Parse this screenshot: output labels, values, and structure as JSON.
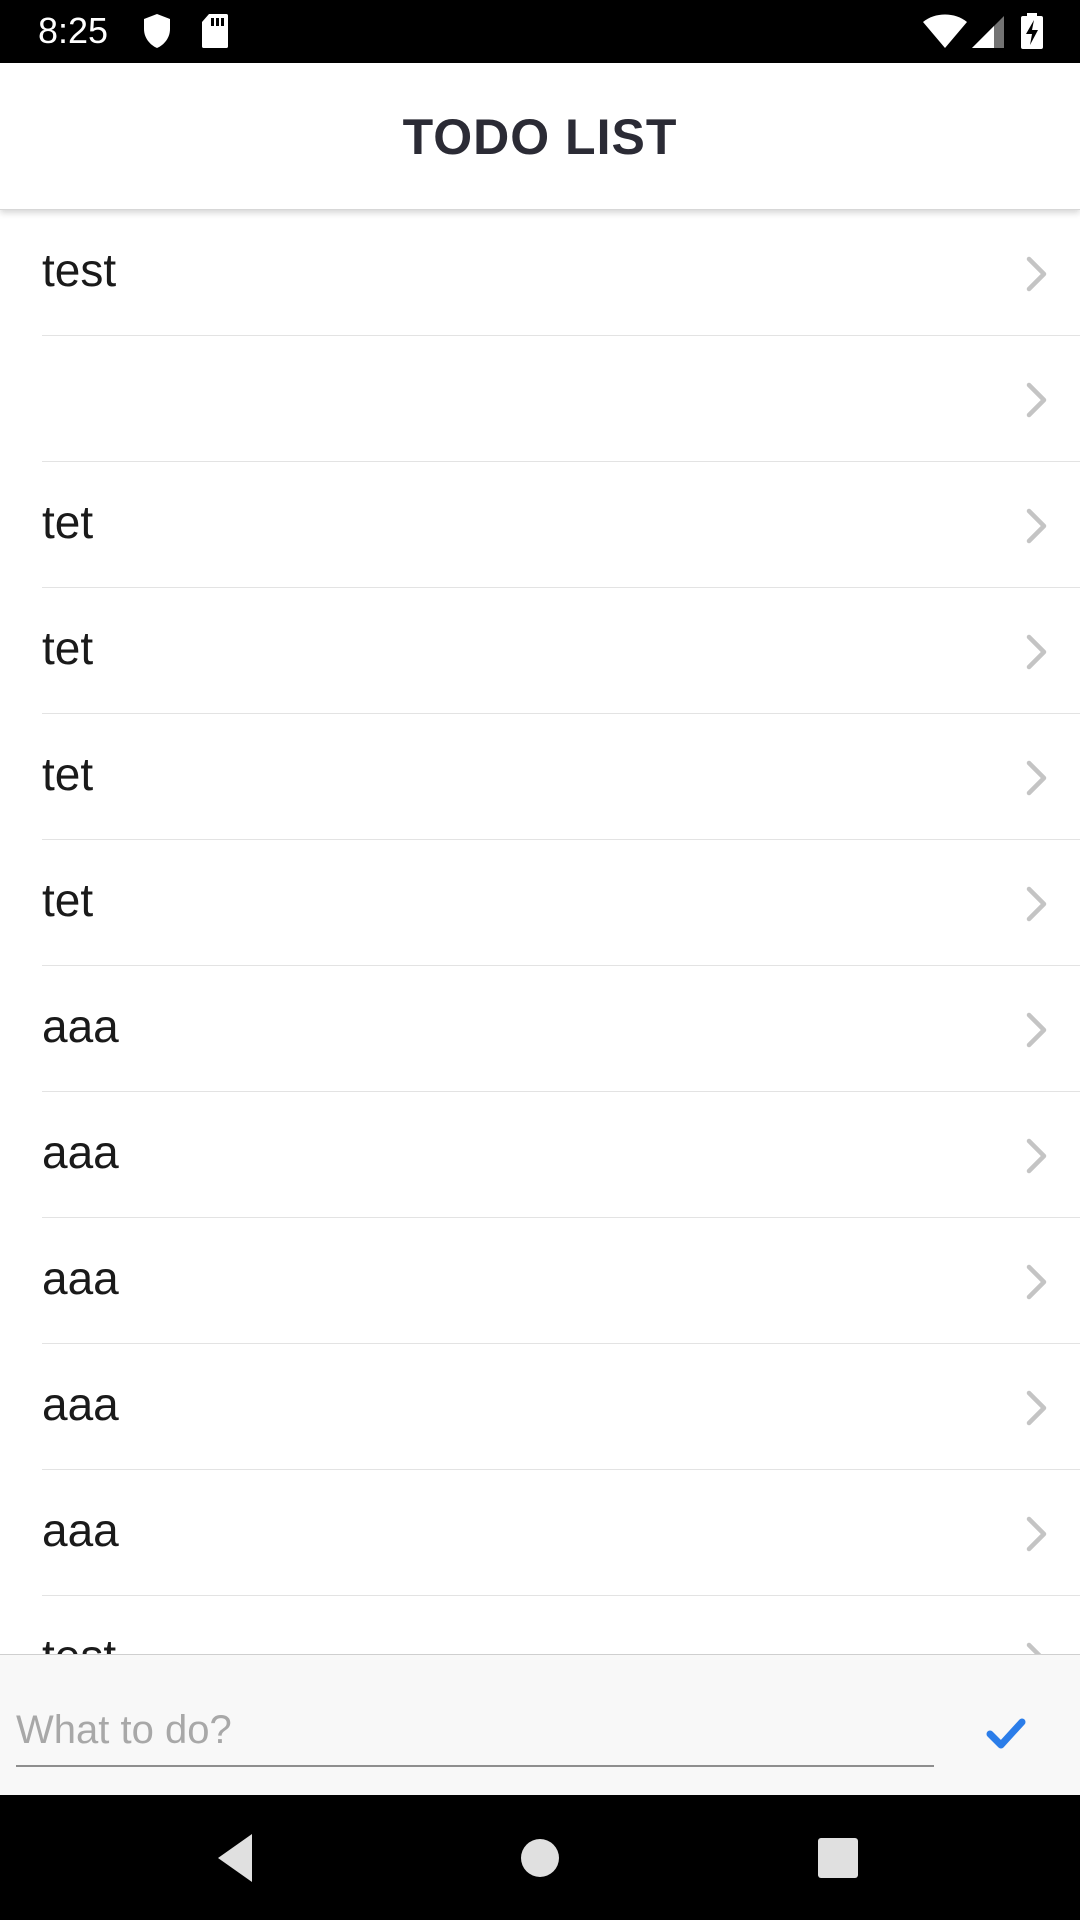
{
  "status_bar": {
    "time": "8:25",
    "left_icons": [
      "shield-icon",
      "sd-card-icon"
    ],
    "right_icons": [
      "wifi-icon",
      "cell-signal-icon",
      "battery-charging-icon"
    ]
  },
  "header": {
    "title": "TODO LIST"
  },
  "todos": [
    {
      "label": "test"
    },
    {
      "label": ""
    },
    {
      "label": "tet"
    },
    {
      "label": "tet"
    },
    {
      "label": "tet"
    },
    {
      "label": "tet"
    },
    {
      "label": "aaa"
    },
    {
      "label": "aaa"
    },
    {
      "label": "aaa"
    },
    {
      "label": "aaa"
    },
    {
      "label": "aaa"
    },
    {
      "label": "test"
    }
  ],
  "input": {
    "value": "",
    "placeholder": "What to do?"
  },
  "submit_icon": "checkmark-icon",
  "nav_bar": {
    "buttons": [
      "back-icon",
      "home-icon",
      "recents-icon"
    ]
  },
  "colors": {
    "accent": "#2b7de9",
    "chevron": "#c4c4c4",
    "title": "#2b2b35"
  }
}
